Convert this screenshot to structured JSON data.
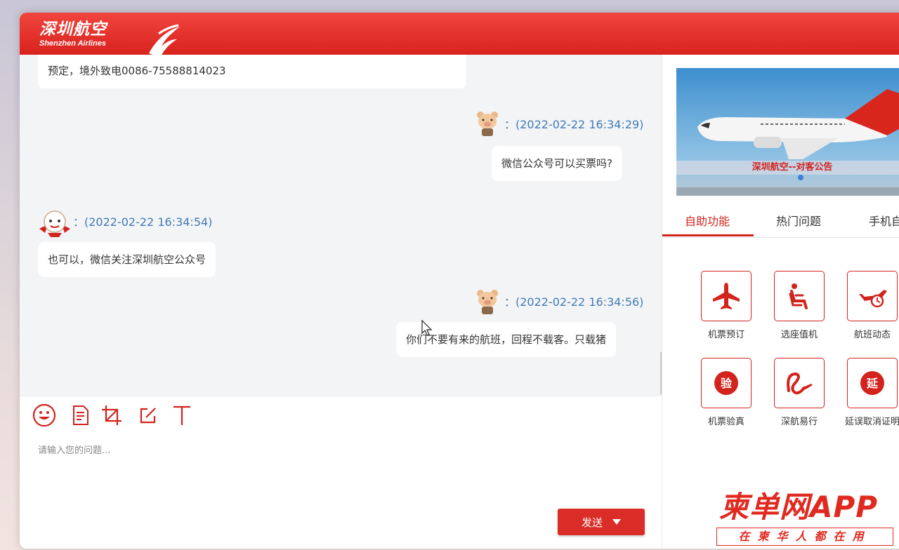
{
  "brand": {
    "name_cn": "深圳航空",
    "name_en": "Shenzhen Airlines",
    "primary_color": "#d9221e"
  },
  "chat": {
    "messages": [
      {
        "from": "bot",
        "text": "预定，境外致电0086-75588814023"
      },
      {
        "from": "user",
        "time": "：(2022-02-22 16:34:29)",
        "text": "微信公众号可以买票吗?"
      },
      {
        "from": "bot",
        "time": "：(2022-02-22 16:34:54)",
        "text": "也可以，微信关注深圳航空公众号"
      },
      {
        "from": "user",
        "time": "：(2022-02-22 16:34:56)",
        "text": "你们不要有来的航班，回程不载客。只载猪"
      }
    ]
  },
  "composer": {
    "tools": [
      "emoji-icon",
      "file-icon",
      "crop-icon",
      "edit-icon",
      "text-icon"
    ],
    "placeholder": "请输入您的问题...",
    "send_label": "发送"
  },
  "right_panel": {
    "banner_caption": "深圳航空--对客公告",
    "tabs": [
      {
        "label": "自助功能",
        "active": true
      },
      {
        "label": "热门问题",
        "active": false
      },
      {
        "label": "手机自",
        "active": false
      }
    ],
    "functions": [
      {
        "label": "机票预订",
        "icon": "airplane-icon"
      },
      {
        "label": "选座值机",
        "icon": "seat-icon"
      },
      {
        "label": "航班动态",
        "icon": "flight-status-icon"
      },
      {
        "label": "机票验真",
        "icon": "verify-icon",
        "icon_text": "验"
      },
      {
        "label": "深航易行",
        "icon": "easy-travel-icon"
      },
      {
        "label": "延误取消证明",
        "icon": "delay-cert-icon",
        "icon_text": "延"
      }
    ]
  },
  "watermark": {
    "title": "柬单网APP",
    "subtitle": "在柬华人都在用"
  }
}
